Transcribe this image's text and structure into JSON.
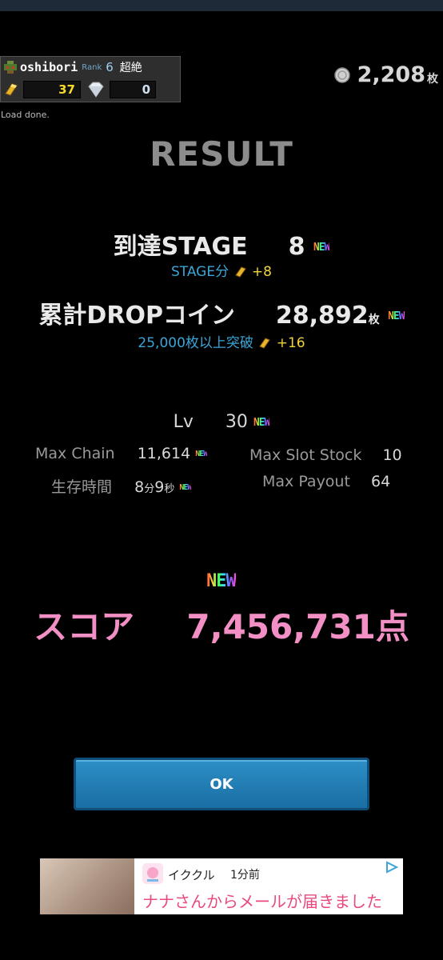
{
  "player": {
    "name": "oshibori",
    "rank_label": "Rank",
    "rank": "6",
    "rank_title": "超絶",
    "gold": "37",
    "gems": "0",
    "load_message": "Load done."
  },
  "coins": {
    "value": "2,208",
    "unit": "枚"
  },
  "result": {
    "title": "RESULT",
    "stage_label": "到達STAGE",
    "stage_value": "8",
    "stage_bonus_label": "STAGE分",
    "stage_bonus": "+8",
    "drop_label": "累計DROPコイン",
    "drop_value": "28,892",
    "drop_unit": "枚",
    "drop_bonus_label": "25,000枚以上突破",
    "drop_bonus": "+16",
    "new_badge": "NEW",
    "lv_label": "Lv",
    "lv_value": "30",
    "max_chain_label": "Max Chain",
    "max_chain_value": "11,614",
    "survival_label": "生存時間",
    "survival_min": "8",
    "survival_min_unit": "分",
    "survival_sec": "9",
    "survival_sec_unit": "秒",
    "max_slot_label": "Max Slot Stock",
    "max_slot_value": "10",
    "max_payout_label": "Max Payout",
    "max_payout_value": "64",
    "score_label": "スコア",
    "score_value": "7,456,731",
    "score_unit": "点"
  },
  "ok_button": "OK",
  "ad": {
    "app_name": "イククル",
    "time": "1分前",
    "message": "ナナさんからメールが届きました"
  },
  "colors": {
    "score": "#f28fc4",
    "bonus": "#3aa6d8",
    "ok": "#2c8fc6"
  }
}
